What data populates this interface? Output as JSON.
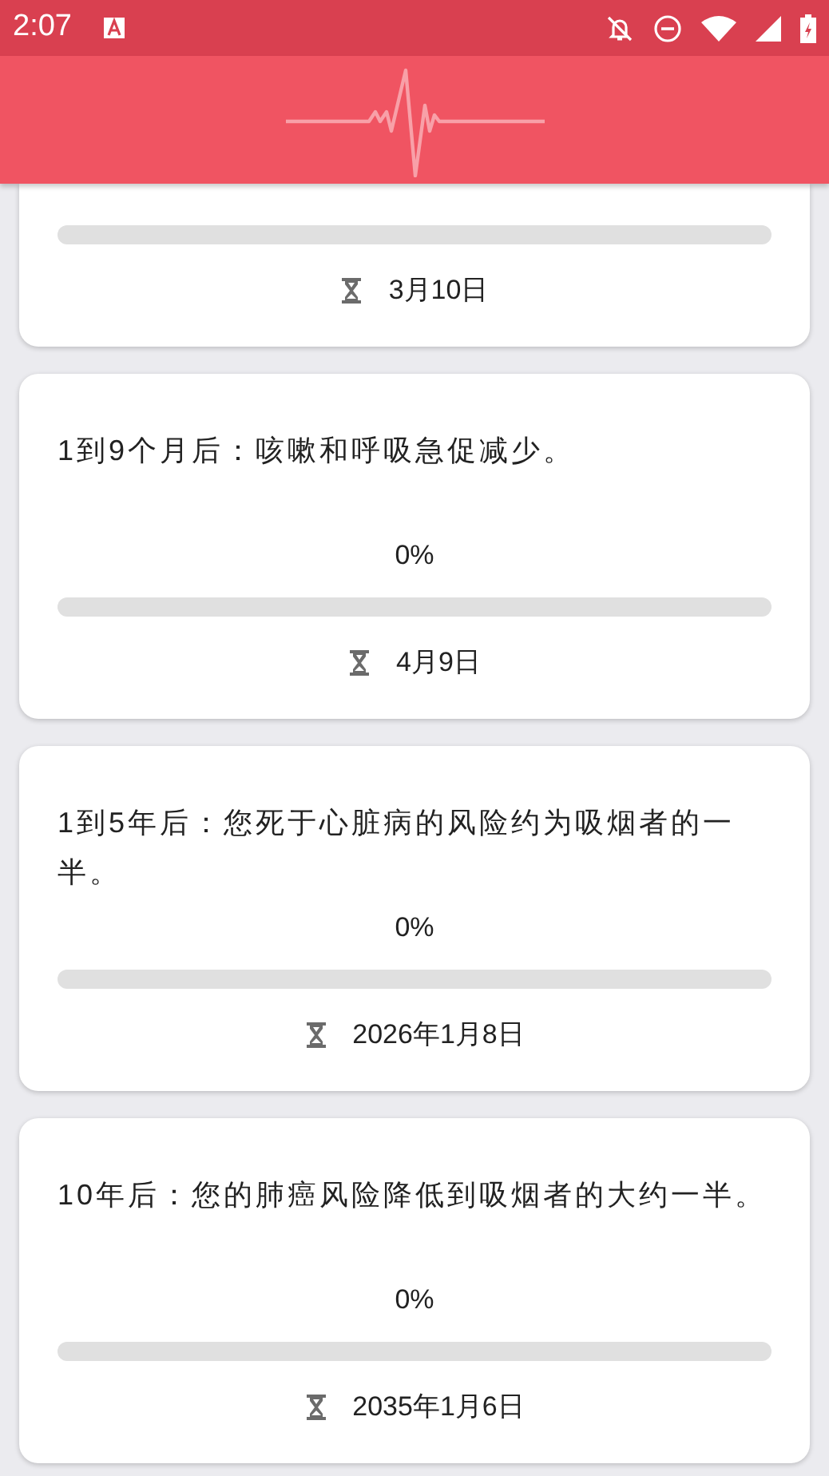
{
  "status_bar": {
    "time": "2:07"
  },
  "milestones": [
    {
      "progress": {
        "level": 0
      },
      "date": "3月10日"
    },
    {
      "title": "1到9个月后：咳嗽和呼吸急促减少。",
      "percent": "0%",
      "progress": {
        "level": 0
      },
      "date": "4月9日"
    },
    {
      "title": "1到5年后：您死于心脏病的风险约为吸烟者的一半。",
      "percent": "0%",
      "progress": {
        "level": 0
      },
      "date": "2026年1月8日"
    },
    {
      "title": "10年后：您的肺癌风险降低到吸烟者的大约一半。",
      "percent": "0%",
      "progress": {
        "level": 0
      },
      "date": "2035年1月6日"
    }
  ]
}
